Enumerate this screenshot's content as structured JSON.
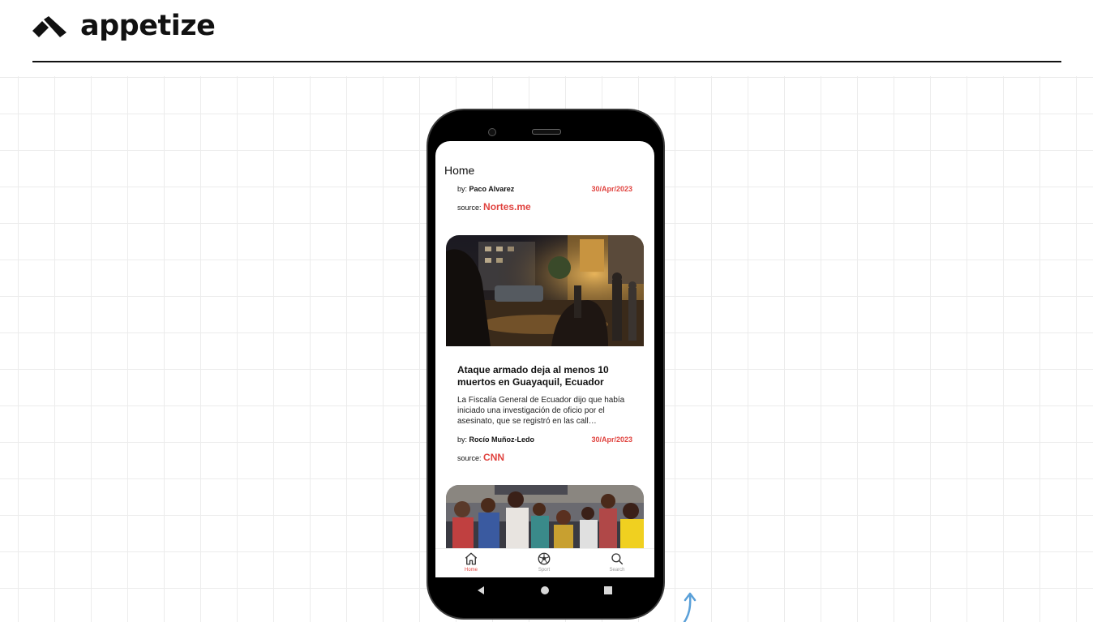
{
  "brand": {
    "name": "appetize"
  },
  "app": {
    "page_title": "Home",
    "articles": [
      {
        "by_label": "by:",
        "author": "Paco Alvarez",
        "date": "30/Apr/2023",
        "source_label": "source:",
        "source": "Nortes.me"
      },
      {
        "image": "night-street-scene",
        "title": "Ataque armado deja al menos 10 muertos en Guayaquil, Ecuador",
        "description": "La Fiscalía General de Ecuador dijo que había iniciado una investigación de oficio por el asesinato, que se registró en las call…",
        "by_label": "by:",
        "author": "Rocío Muñoz-Ledo",
        "date": "30/Apr/2023",
        "source_label": "source:",
        "source": "CNN"
      },
      {
        "image": "crowd-people-scene"
      }
    ],
    "bottom_nav": [
      {
        "label": "Home",
        "icon": "home-icon",
        "active": true
      },
      {
        "label": "Sport",
        "icon": "soccer-ball-icon",
        "active": false
      },
      {
        "label": "Search",
        "icon": "search-icon",
        "active": false
      }
    ]
  },
  "colors": {
    "accent": "#e0433f",
    "phone_frame": "#000000",
    "text": "#111111"
  }
}
